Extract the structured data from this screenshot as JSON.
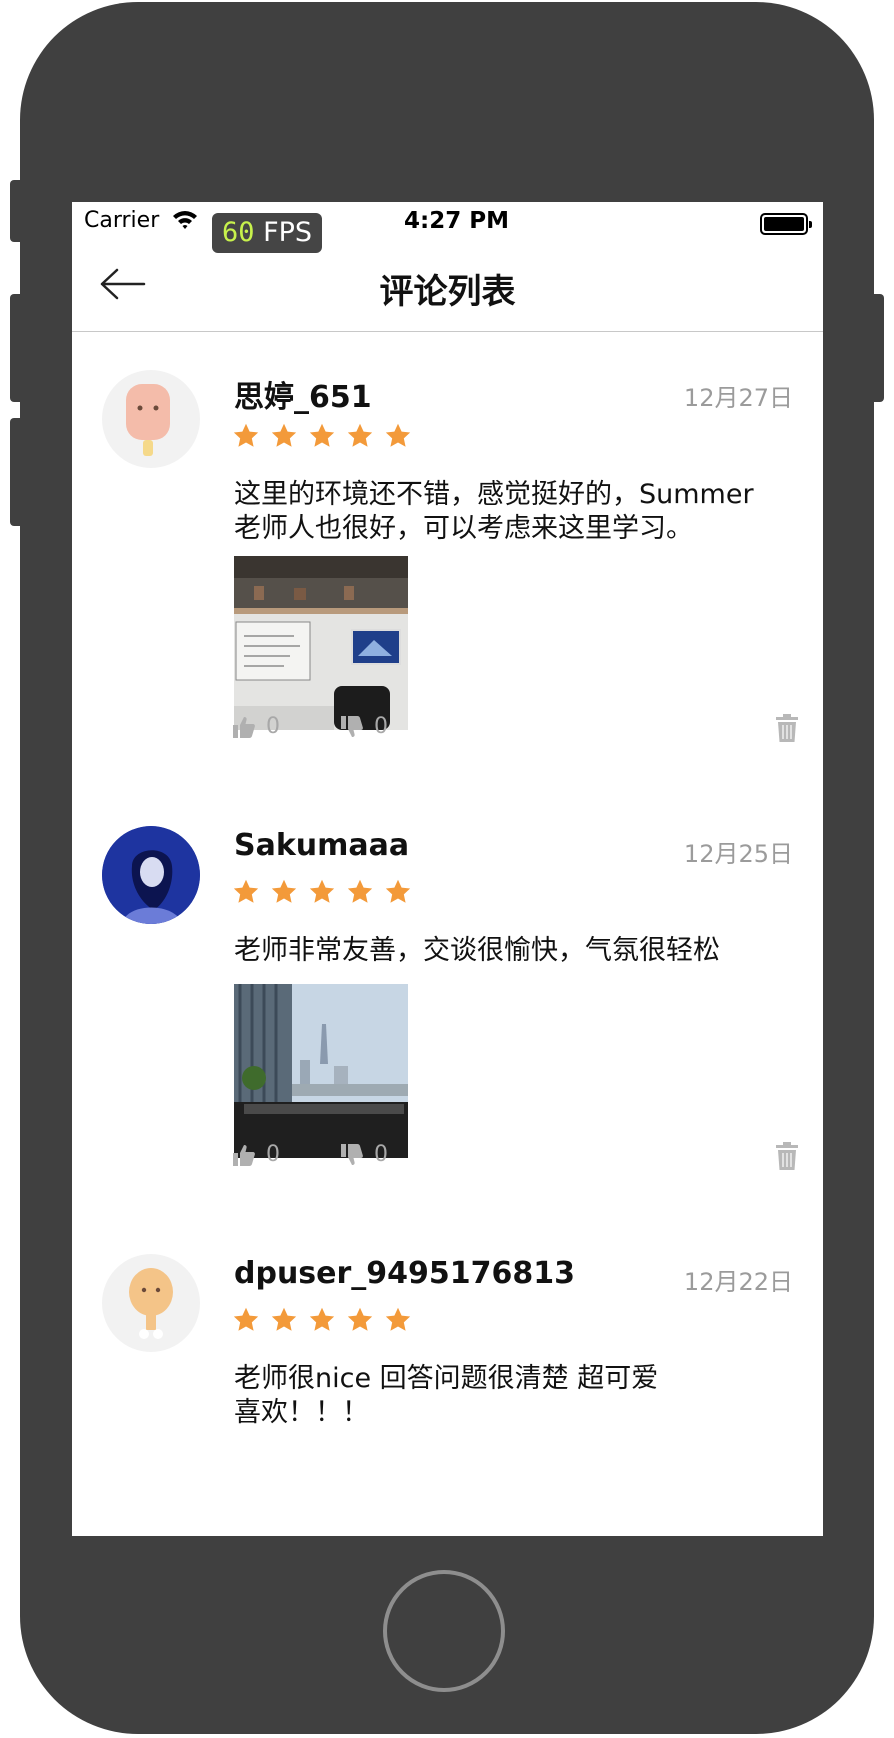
{
  "status_bar": {
    "carrier": "Carrier",
    "fps_value": "60",
    "fps_unit": "FPS",
    "time": "4:27 PM"
  },
  "nav": {
    "title": "评论列表",
    "back_icon": "arrow-left-icon"
  },
  "colors": {
    "star": "#f39a3a",
    "muted": "#a8a8a8",
    "device": "#404040"
  },
  "comments": [
    {
      "user": "思婷_651",
      "date": "12月27日",
      "rating": 5,
      "text_line1": "这里的环境还不错，感觉挺好的，Summer",
      "text_line2": "老师人也很好，可以考虑来这里学习。",
      "likes": "0",
      "dislikes": "0"
    },
    {
      "user": "Sakumaaa",
      "date": "12月25日",
      "rating": 5,
      "text_line1": "老师非常友善，交谈很愉快，气氛很轻松",
      "likes": "0",
      "dislikes": "0"
    },
    {
      "user": "dpuser_9495176813",
      "date": "12月22日",
      "rating": 5,
      "text_line1": "老师很nice 回答问题很清楚 超可爱",
      "text_line2": "喜欢！！！"
    }
  ]
}
